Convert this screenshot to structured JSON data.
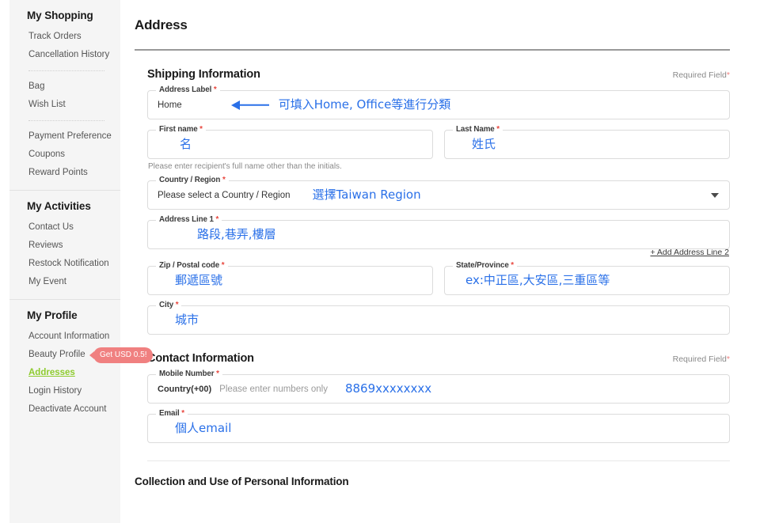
{
  "sidebar": {
    "groups": [
      {
        "title": "My Shopping",
        "blocks": [
          {
            "items": [
              {
                "label": "Track Orders"
              },
              {
                "label": "Cancellation History"
              }
            ]
          },
          {
            "items": [
              {
                "label": "Bag"
              },
              {
                "label": "Wish List"
              }
            ]
          },
          {
            "items": [
              {
                "label": "Payment Preference"
              },
              {
                "label": "Coupons"
              },
              {
                "label": "Reward Points"
              }
            ]
          }
        ]
      },
      {
        "title": "My Activities",
        "blocks": [
          {
            "items": [
              {
                "label": "Contact Us"
              },
              {
                "label": "Reviews"
              },
              {
                "label": "Restock Notification"
              },
              {
                "label": "My Event"
              }
            ]
          }
        ]
      },
      {
        "title": "My Profile",
        "blocks": [
          {
            "items": [
              {
                "label": "Account Information"
              },
              {
                "label": "Beauty Profile",
                "badge": "Get USD 0.5!"
              },
              {
                "label": "Addresses",
                "active": true
              },
              {
                "label": "Login History"
              },
              {
                "label": "Deactivate Account"
              }
            ]
          }
        ]
      }
    ]
  },
  "page": {
    "title": "Address"
  },
  "shipping": {
    "section_title": "Shipping Information",
    "required_note": "Required Field",
    "required_asterisk": "*",
    "address_label": {
      "legend": "Address Label",
      "value": "Home",
      "annotation": "可填入Home, Office等進行分類"
    },
    "first_name": {
      "legend": "First name",
      "annotation": "名"
    },
    "last_name": {
      "legend": "Last Name",
      "annotation": "姓氏"
    },
    "helper": "Please enter recipient's full name other than the initials.",
    "country": {
      "legend": "Country / Region",
      "value": "Please select a Country / Region",
      "annotation": "選擇Taiwan Region"
    },
    "address_line_1": {
      "legend": "Address Line 1",
      "annotation": "路段,巷弄,樓層"
    },
    "add_address_line_2": "+ Add Address Line 2",
    "zip": {
      "legend": "Zip / Postal code",
      "annotation": "郵遞區號"
    },
    "state": {
      "legend": "State/Province",
      "annotation": "ex:中正區,大安區,三重區等"
    },
    "city": {
      "legend": "City",
      "annotation": "城市"
    }
  },
  "contact": {
    "section_title": "Contact Information",
    "required_note": "Required Field",
    "required_asterisk": "*",
    "mobile": {
      "legend": "Mobile Number",
      "prefix": "Country(+00)",
      "placeholder": "Please enter numbers only",
      "annotation": "8869xxxxxxxx"
    },
    "email": {
      "legend": "Email",
      "annotation": "個人email"
    }
  },
  "footer": {
    "title": "Collection and Use of Personal Information"
  },
  "colors": {
    "annotation_blue": "#2a70e8",
    "active_green": "#8ecb2e",
    "badge_coral": "#f08080",
    "required_red": "#e8453c",
    "sidebar_bg": "#f5f5f5"
  }
}
